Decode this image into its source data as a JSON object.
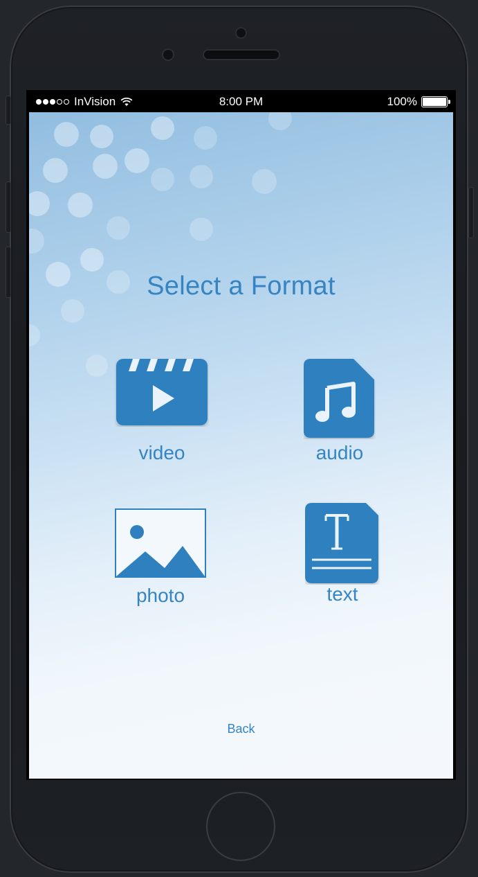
{
  "status_bar": {
    "carrier": "InVision",
    "time": "8:00 PM",
    "battery": "100%"
  },
  "screen": {
    "title": "Select a Format",
    "formats": [
      {
        "label": "video",
        "icon": "video-clapper-icon"
      },
      {
        "label": "audio",
        "icon": "music-file-icon"
      },
      {
        "label": "photo",
        "icon": "photo-landscape-icon"
      },
      {
        "label": "text",
        "icon": "text-document-icon"
      }
    ],
    "back_label": "Back"
  },
  "colors": {
    "accent": "#3684c1",
    "icon_fill": "#2f80bf"
  }
}
